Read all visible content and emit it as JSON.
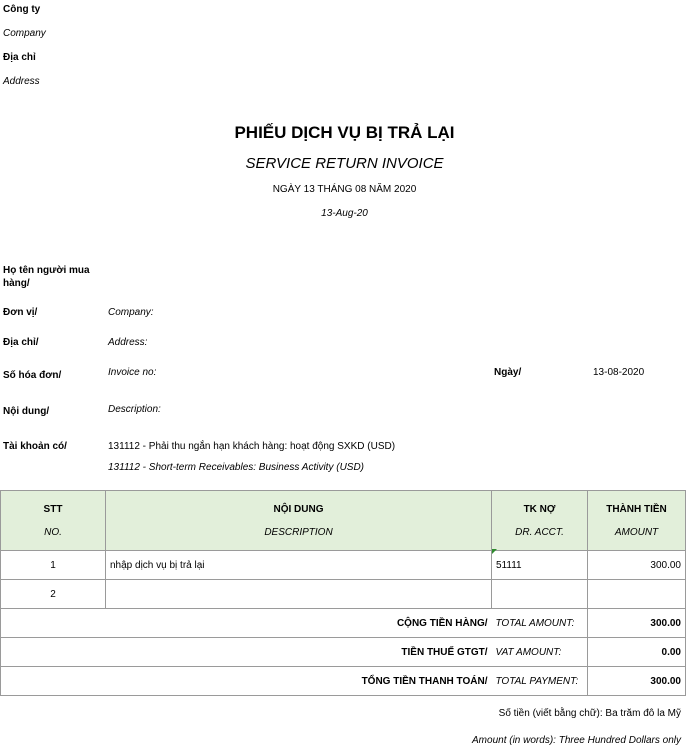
{
  "company": {
    "label": "Công ty",
    "label_en": "Company",
    "address_label": "Địa chỉ",
    "address_label_en": "Address"
  },
  "doc": {
    "title": "PHIẾU DỊCH VỤ BỊ TRẢ LẠI",
    "subtitle": "SERVICE RETURN INVOICE",
    "date_vn": "NGÀY 13 THÁNG 08 NĂM 2020",
    "date_en": "13-Aug-20"
  },
  "info": {
    "buyer_label_1": "Họ tên người mua",
    "buyer_label_2": "hàng/",
    "unit_label": "Đơn vị/",
    "unit_en": "Company:",
    "address_label": "Địa chỉ/",
    "address_en": "Address:",
    "invoice_label": "Số hóa đơn/",
    "invoice_en": "Invoice no:",
    "date_label": "Ngày/",
    "date_value": "13-08-2020",
    "content_label": "Nội dung/",
    "content_en": "Description:",
    "credit_label": "Tài khoản có/",
    "credit_vn": "131112 -  Phải thu ngắn hạn khách hàng: hoạt động SXKD (USD)",
    "credit_en": "131112 -  Short-term Receivables: Business Activity (USD)"
  },
  "table": {
    "headers": [
      {
        "vn": "STT",
        "en": "NO."
      },
      {
        "vn": "NỘI DUNG",
        "en": "DESCRIPTION"
      },
      {
        "vn": "TK NỢ",
        "en": "DR. ACCT."
      },
      {
        "vn": "THÀNH TIỀN",
        "en": "AMOUNT"
      }
    ],
    "rows": [
      {
        "no": "1",
        "desc": "nhập dịch vụ bị trả lại",
        "acct": "51111",
        "amount": "300.00"
      },
      {
        "no": "2",
        "desc": "",
        "acct": "",
        "amount": ""
      }
    ],
    "totals": [
      {
        "vn": "CỘNG TIỀN HÀNG/",
        "en": "TOTAL AMOUNT:",
        "value": "300.00"
      },
      {
        "vn": "TIỀN THUẾ GTGT/",
        "en": "VAT AMOUNT:",
        "value": "0.00"
      },
      {
        "vn": "TỔNG TIỀN THANH TOÁN/",
        "en": "TOTAL PAYMENT:",
        "value": "300.00"
      }
    ]
  },
  "words": {
    "vn": "Số tiền (viết bằng chữ): Ba trăm đô la Mỹ",
    "en": "Amount (in words): Three Hundred Dollars only"
  }
}
